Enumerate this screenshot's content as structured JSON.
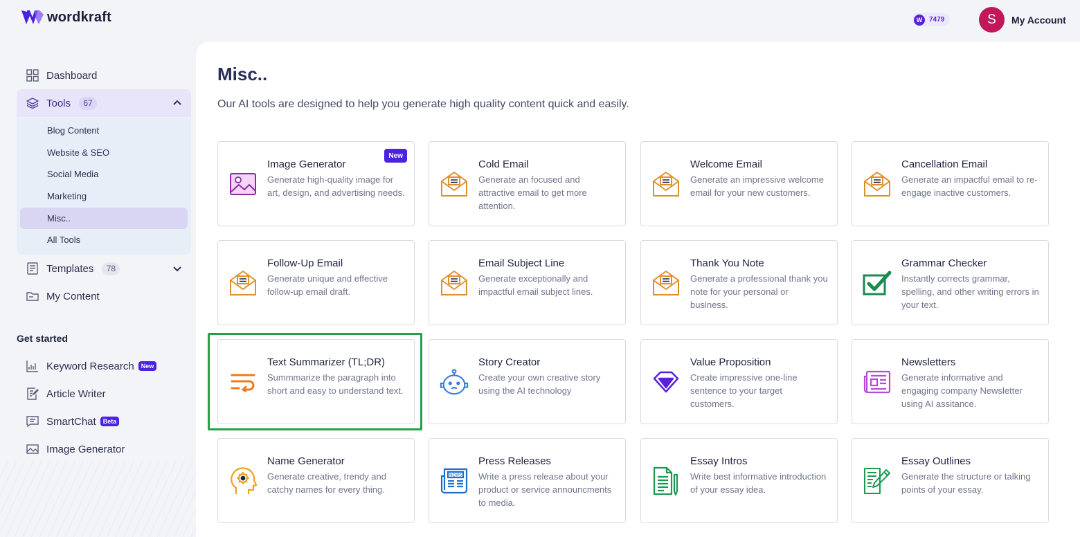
{
  "header": {
    "brand": "wordkraft",
    "credits_letter": "W",
    "credits": "7479",
    "avatar_letter": "S",
    "account_label": "My Account"
  },
  "sidebar": {
    "dashboard": "Dashboard",
    "tools": {
      "label": "Tools",
      "count": "67"
    },
    "tool_subitems": [
      "Blog Content",
      "Website & SEO",
      "Social Media",
      "Marketing",
      "Misc..",
      "All Tools"
    ],
    "templates": {
      "label": "Templates",
      "count": "78"
    },
    "my_content": "My Content",
    "get_started_title": "Get started",
    "get_started": [
      {
        "label": "Keyword Research",
        "badge": "New"
      },
      {
        "label": "Article Writer",
        "badge": ""
      },
      {
        "label": "SmartChat",
        "badge": "Beta"
      },
      {
        "label": "Image Generator",
        "badge": ""
      }
    ]
  },
  "main": {
    "title": "Misc..",
    "subtitle": "Our AI tools are designed to help you generate high quality content quick and easily.",
    "cards": [
      {
        "title": "Image Generator",
        "desc": "Generate high-quality image for art, design, and advertising needs.",
        "icon": "image-icon",
        "badge": "New"
      },
      {
        "title": "Cold Email",
        "desc": "Generate an focused and attractive email to get more attention.",
        "icon": "envelope-icon",
        "badge": ""
      },
      {
        "title": "Welcome Email",
        "desc": "Generate an impressive welcome email for your new customers.",
        "icon": "envelope-icon",
        "badge": ""
      },
      {
        "title": "Cancellation Email",
        "desc": "Generate an impactful email to re-engage inactive customers.",
        "icon": "envelope-icon",
        "badge": ""
      },
      {
        "title": "Follow-Up Email",
        "desc": "Generate unique and effective follow-up email draft.",
        "icon": "envelope-icon",
        "badge": ""
      },
      {
        "title": "Email Subject Line",
        "desc": "Generate exceptionally and impactful email subject lines.",
        "icon": "envelope-icon",
        "badge": ""
      },
      {
        "title": "Thank You Note",
        "desc": "Generate a professional thank you note for your personal or business.",
        "icon": "envelope-icon",
        "badge": ""
      },
      {
        "title": "Grammar Checker",
        "desc": "Instantly corrects grammar, spelling, and other writing errors in your text.",
        "icon": "checkbox-icon",
        "badge": ""
      },
      {
        "title": "Text Summarizer (TL;DR)",
        "desc": "Summmarize the paragraph into short and easy to understand text.",
        "icon": "text-wrap-icon",
        "badge": ""
      },
      {
        "title": "Story Creator",
        "desc": "Create your own creative story using the AI technology",
        "icon": "robot-icon",
        "badge": ""
      },
      {
        "title": "Value Proposition",
        "desc": "Create impressive one-line sentence to your target customers.",
        "icon": "diamond-icon",
        "badge": ""
      },
      {
        "title": "Newsletters",
        "desc": "Generate informative and engaging company Newsletter using AI assitance.",
        "icon": "newsletter-icon",
        "badge": ""
      },
      {
        "title": "Name Generator",
        "desc": "Generate creative, trendy and catchy names for every thing.",
        "icon": "head-gear-icon",
        "badge": ""
      },
      {
        "title": "Press Releases",
        "desc": "Write a press release about your product or service announcments to media.",
        "icon": "news-icon",
        "badge": ""
      },
      {
        "title": "Essay Intros",
        "desc": "Write best informative introduction of your essay idea.",
        "icon": "document-pen-icon",
        "badge": ""
      },
      {
        "title": "Essay Outlines",
        "desc": "Generate the structure or talking points of your essay.",
        "icon": "document-edit-icon",
        "badge": ""
      }
    ]
  },
  "colors": {
    "accent": "#4a22e0",
    "highlight": "#1fa347",
    "envelope": "#e0902a"
  }
}
